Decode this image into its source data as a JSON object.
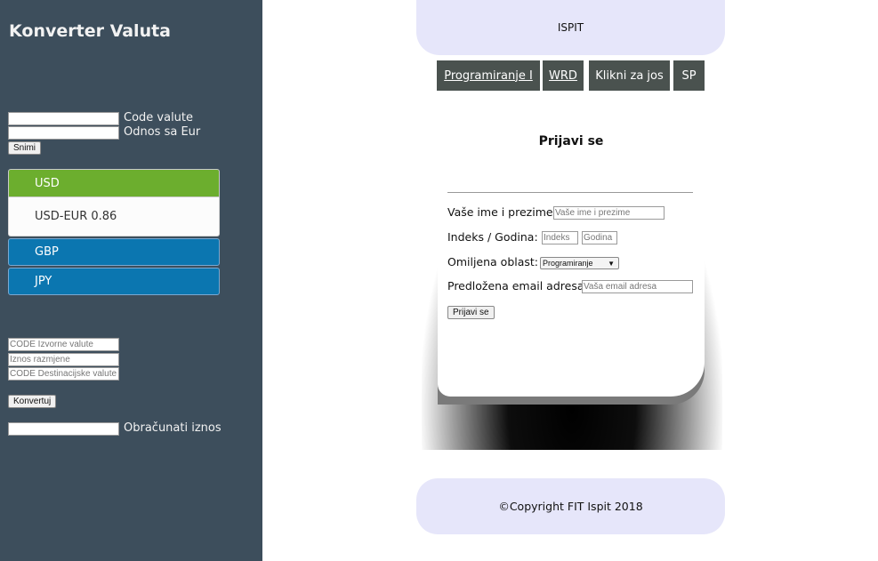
{
  "sidebar": {
    "title": "Konverter Valuta",
    "code_label": "Code valute",
    "ratio_label": "Odnos sa Eur",
    "save_button": "Snimi",
    "currencies": {
      "usd": {
        "label": "USD",
        "detail": "USD-EUR 0.86"
      },
      "gbp": {
        "label": "GBP"
      },
      "jpy": {
        "label": "JPY"
      }
    },
    "source_placeholder": "CODE Izvorne valute",
    "amount_placeholder": "Iznos razmjene",
    "dest_placeholder": "CODE Destinacijske valute",
    "convert_button": "Konvertuj",
    "result_label": "Obračunati iznos"
  },
  "header": {
    "title": "ISPIT"
  },
  "nav": {
    "items": [
      {
        "label": "Programiranje I"
      },
      {
        "label": "WRD"
      },
      {
        "label": "Klikni za jos"
      },
      {
        "label": "SP"
      }
    ]
  },
  "form": {
    "title": "Prijavi se",
    "name_label": "Vaše ime i prezime",
    "name_placeholder": "Vaše ime i prezime",
    "index_label": "Indeks / Godina:",
    "index_placeholder": "Indeks",
    "year_placeholder": "Godina",
    "area_label": "Omiljena oblast:",
    "area_selected": "Programiranje",
    "email_label": "Predložena email adresa",
    "email_placeholder": "Vaša email adresa",
    "submit": "Prijavi se"
  },
  "footer": {
    "text": "©Copyright FIT Ispit 2018"
  },
  "colors": {
    "sidebar_bg": "#3d4e5c",
    "accent_green": "#6cae2e",
    "accent_blue": "#0b76b0",
    "nav_bg": "#4a524f",
    "lavender": "#e6e6fa"
  }
}
